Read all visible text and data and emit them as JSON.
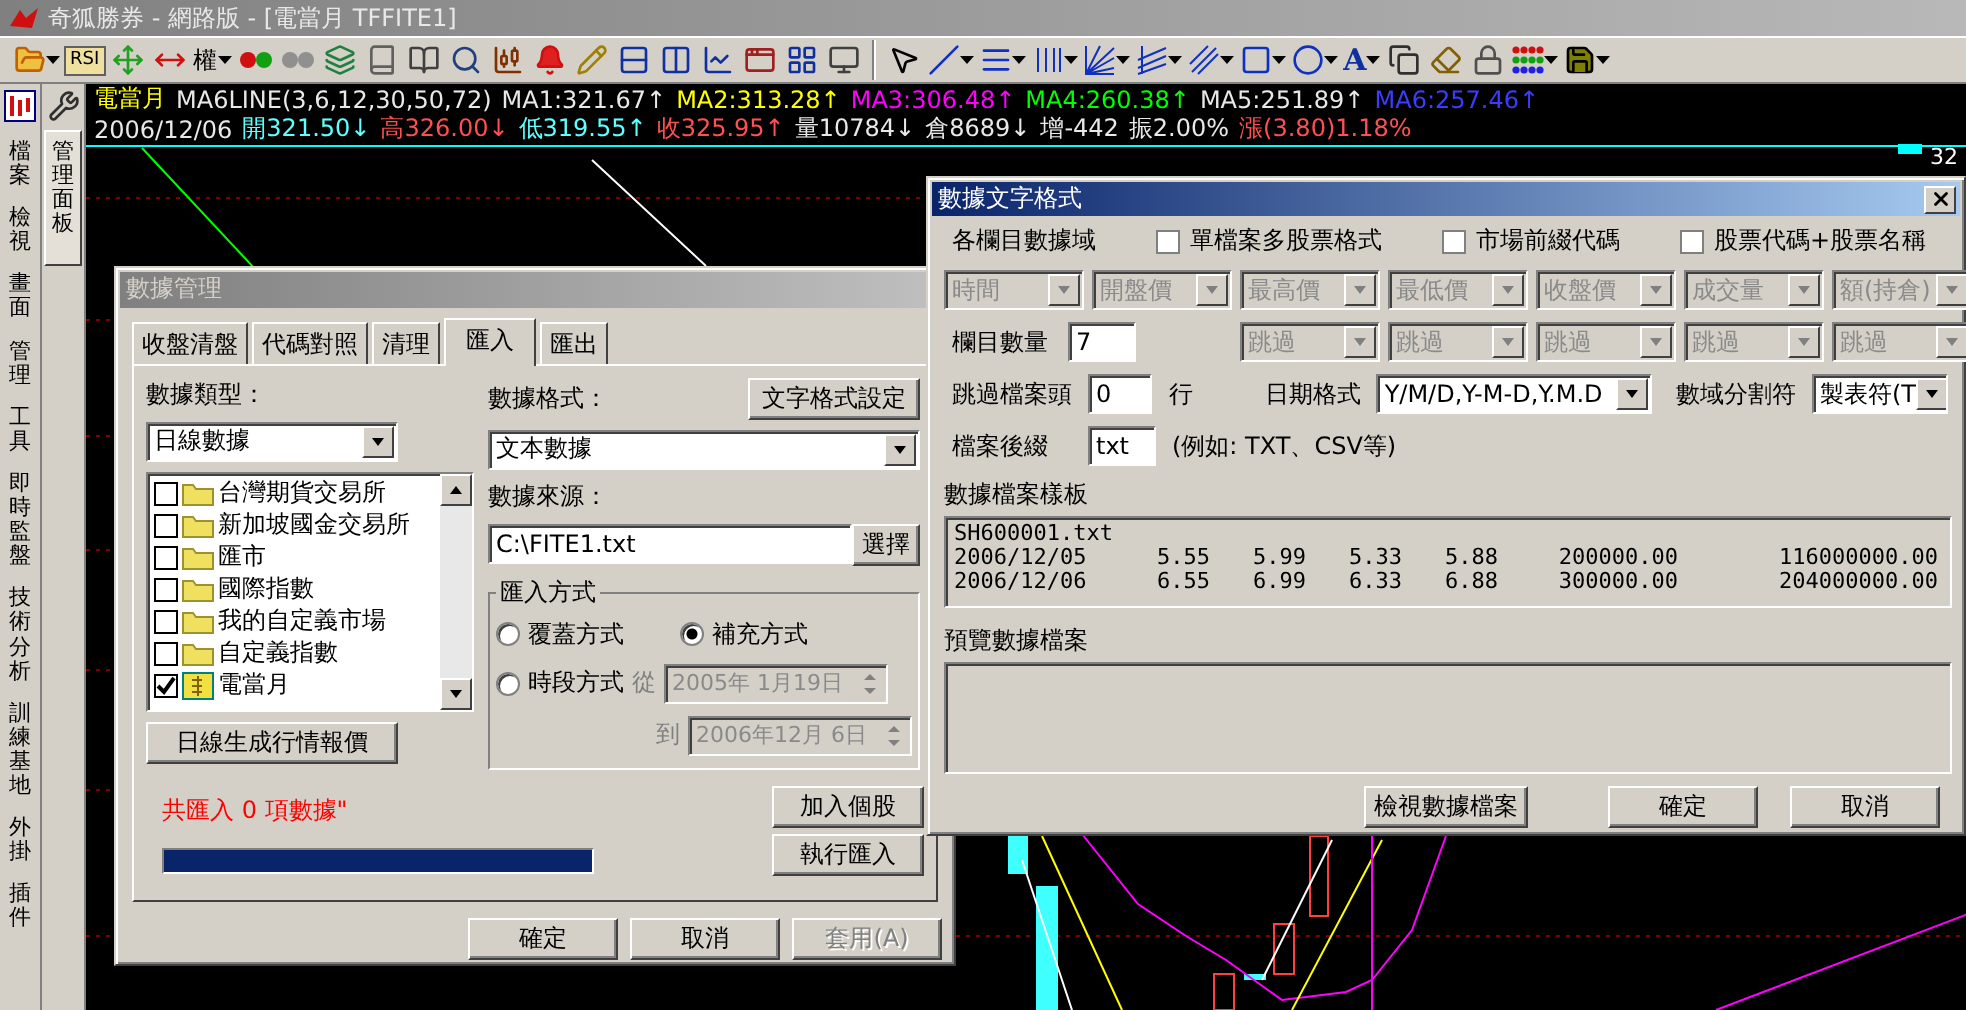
{
  "window": {
    "title": "奇狐勝券 - 網路版 - [電當月 TFFITE1]"
  },
  "toolbar": {
    "indicator_label": "RSI",
    "rights_label": "權",
    "text_tool_label": "A"
  },
  "side_tabs": [
    {
      "label": "檔案"
    },
    {
      "label": "檢視"
    },
    {
      "label": "畫面"
    },
    {
      "label": "管理"
    },
    {
      "label": "工具"
    },
    {
      "label": "即時監盤"
    },
    {
      "label": "技術分析"
    },
    {
      "label": "訓練基地"
    },
    {
      "label": "外掛"
    },
    {
      "label": "插件"
    }
  ],
  "panel_tab": {
    "label": "管理面板",
    "selected": true
  },
  "chart": {
    "line1": [
      {
        "text": "電當月",
        "color": "#ffff00"
      },
      {
        "text": "MA6LINE(3,6,12,30,50,72)",
        "color": "#e8e8e8"
      },
      {
        "text": "MA1:321.67↑",
        "color": "#e8e8e8"
      },
      {
        "text": "MA2:313.28↑",
        "color": "#ffff00"
      },
      {
        "text": "MA3:306.48↑",
        "color": "#ff00ff"
      },
      {
        "text": "MA4:260.38↑",
        "color": "#00ff00"
      },
      {
        "text": "MA5:251.89↑",
        "color": "#e8e8e8"
      },
      {
        "text": "MA6:257.46↑",
        "color": "#3c3cff"
      }
    ],
    "line2": [
      {
        "text": "2006/12/06",
        "color": "#e8e8e8"
      },
      {
        "text": "開321.50↓",
        "color": "#60ffff"
      },
      {
        "text": "高326.00↓",
        "color": "#ff5050"
      },
      {
        "text": "低319.55↑",
        "color": "#60ffff"
      },
      {
        "text": "收325.95↑",
        "color": "#ff5050"
      },
      {
        "text": "量10784↓",
        "color": "#e8e8e8"
      },
      {
        "text": "倉8689↓",
        "color": "#e8e8e8"
      },
      {
        "text": "增-442",
        "color": "#e8e8e8"
      },
      {
        "text": "振2.00%",
        "color": "#e8e8e8"
      },
      {
        "text": "漲(3.80)1.18%",
        "color": "#ff5050"
      }
    ],
    "price_label": "32"
  },
  "data_manager": {
    "title": "數據管理",
    "tabs": [
      {
        "label": "收盤清盤",
        "selected": false
      },
      {
        "label": "代碼對照",
        "selected": false
      },
      {
        "label": "清理",
        "selected": false
      },
      {
        "label": "匯入",
        "selected": true
      },
      {
        "label": "匯出",
        "selected": false
      }
    ],
    "type_label": "數據類型：",
    "type_value": "日線數據",
    "format_label": "數據格式：",
    "format_settings_button": "文字格式設定",
    "format_value": "文本數據",
    "markets": [
      {
        "label": "台灣期貨交易所",
        "kind": "folder",
        "checked": false
      },
      {
        "label": "新加坡國金交易所",
        "kind": "folder",
        "checked": false
      },
      {
        "label": "匯市",
        "kind": "folder",
        "checked": false
      },
      {
        "label": "國際指數",
        "kind": "folder",
        "checked": false
      },
      {
        "label": "我的自定義市場",
        "kind": "folder",
        "checked": false
      },
      {
        "label": "自定義指數",
        "kind": "folder",
        "checked": false
      },
      {
        "label": "電當月",
        "kind": "stock",
        "checked": true
      }
    ],
    "source_label": "數據來源：",
    "source_value": "C:\\FITE1.txt",
    "browse_button": "選擇",
    "import_mode": {
      "title": "匯入方式",
      "options": [
        {
          "label": "覆蓋方式",
          "selected": false
        },
        {
          "label": "補充方式",
          "selected": true
        },
        {
          "label": "時段方式",
          "selected": false
        }
      ],
      "from_label": "從",
      "from_value": "2005年 1月19日",
      "to_label": "到",
      "to_value": "2006年12月 6日",
      "dates_disabled": true
    },
    "generate_button": "日線生成行情報價",
    "status": "共匯入 0 項數據\"",
    "progress": {
      "level": 1
    },
    "add_button": "加入個股",
    "run_button": "執行匯入",
    "buttons": [
      {
        "label": "確定",
        "disabled": false
      },
      {
        "label": "取消",
        "disabled": false
      },
      {
        "label": "套用(A)",
        "disabled": true
      }
    ]
  },
  "text_format": {
    "title": "數據文字格式",
    "fields_label": "各欄目數據域",
    "options": [
      {
        "label": "單檔案多股票格式",
        "checked": false
      },
      {
        "label": "市場前綴代碼",
        "checked": false
      },
      {
        "label": "股票代碼+股票名稱",
        "checked": false
      }
    ],
    "columns": [
      {
        "label": "時間",
        "disabled": true
      },
      {
        "label": "開盤價",
        "disabled": true
      },
      {
        "label": "最高價",
        "disabled": true
      },
      {
        "label": "最低價",
        "disabled": true
      },
      {
        "label": "收盤價",
        "disabled": true
      },
      {
        "label": "成交量",
        "disabled": true
      },
      {
        "label": "額(持倉)",
        "disabled": true
      }
    ],
    "count_label": "欄目數量",
    "count_value": "7",
    "extra_columns": [
      {
        "label": "跳過",
        "disabled": true
      },
      {
        "label": "跳過",
        "disabled": true
      },
      {
        "label": "跳過",
        "disabled": true
      },
      {
        "label": "跳過",
        "disabled": true
      },
      {
        "label": "跳過",
        "disabled": true
      }
    ],
    "skip_label": "跳過檔案頭",
    "skip_value": "0",
    "skip_unit": "行",
    "date_label": "日期格式",
    "date_value": "Y/M/D,Y-M-D,Y.M.D",
    "separator_label": "數域分割符",
    "separator_value": "製表符(T",
    "suffix_label": "檔案後綴",
    "suffix_value": "txt",
    "suffix_hint": "(例如: TXT、CSV等)",
    "template_label": "數據檔案樣板",
    "template": {
      "file": "SH600001.txt",
      "rows": [
        [
          "2006/12/05",
          "5.55",
          "5.99",
          "5.33",
          "5.88",
          "200000.00",
          "116000000.00"
        ],
        [
          "2006/12/06",
          "6.55",
          "6.99",
          "6.33",
          "6.88",
          "300000.00",
          "204000000.00"
        ]
      ]
    },
    "preview_label": "預覽數據檔案",
    "buttons": [
      {
        "label": "檢視數據檔案"
      },
      {
        "label": "確定"
      },
      {
        "label": "取消"
      }
    ]
  }
}
